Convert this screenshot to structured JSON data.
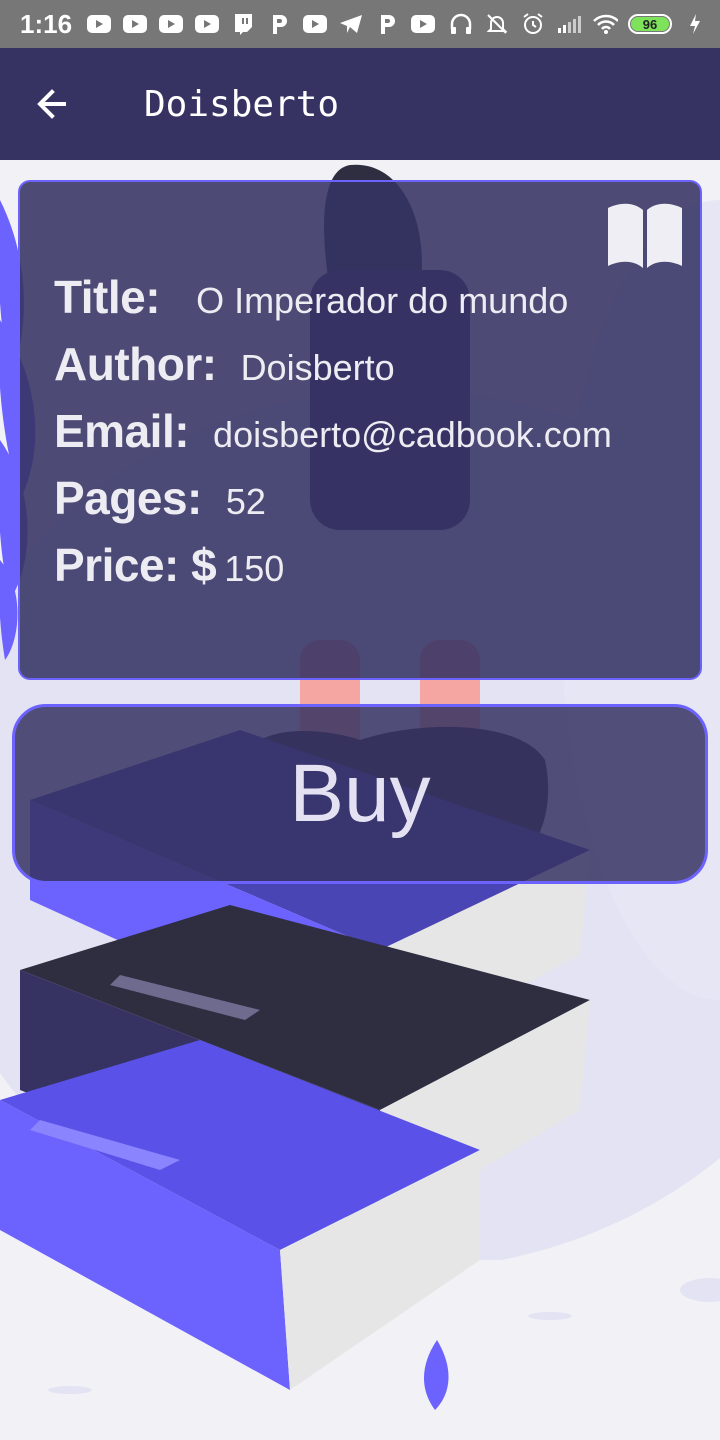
{
  "status_bar": {
    "time": "1:16",
    "battery": "96",
    "notification_icons": [
      "youtube-icon",
      "youtube-icon",
      "youtube-icon",
      "youtube-icon",
      "twitch-icon",
      "p-icon",
      "youtube-icon",
      "telegram-icon",
      "p-icon",
      "youtube-icon"
    ],
    "system_icons": [
      "headphones-icon",
      "mute-bell-icon",
      "alarm-icon",
      "signal-icon",
      "wifi-icon",
      "battery-icon",
      "charging-icon"
    ]
  },
  "app_bar": {
    "back_icon": "arrow-back-icon",
    "title": "Doisberto"
  },
  "book": {
    "icon": "book-open-icon",
    "title_label": "Title:",
    "title_value": "O Imperador do mundo",
    "author_label": "Author:",
    "author_value": "Doisberto",
    "email_label": "Email:",
    "email_value": "doisberto@cadbook.com",
    "pages_label": "Pages:",
    "pages_value": "52",
    "price_label": "Price: $",
    "price_value": "150"
  },
  "actions": {
    "buy_label": "Buy"
  },
  "colors": {
    "app_bar": "#363363",
    "accent": "#6c63ff",
    "card_bg": "#363363",
    "status_bar": "#777777"
  }
}
